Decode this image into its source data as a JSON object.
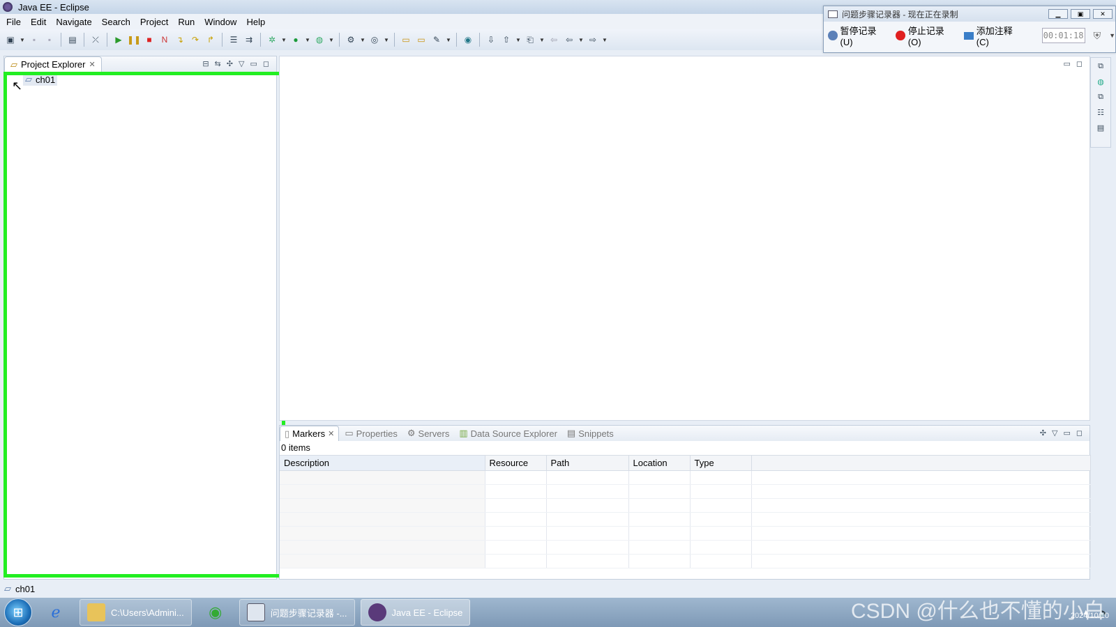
{
  "window": {
    "title": "Java EE - Eclipse"
  },
  "menu": [
    "File",
    "Edit",
    "Navigate",
    "Search",
    "Project",
    "Run",
    "Window",
    "Help"
  ],
  "toolbar": {
    "icons": [
      "new-icon",
      "save-icon",
      "save-all-icon",
      "print-icon",
      "skip-breakpoints-icon",
      "resume-icon",
      "suspend-icon",
      "terminate-icon",
      "disconnect-icon",
      "step-into-icon",
      "step-over-icon",
      "step-return-icon",
      "drop-to-frame-icon",
      "use-step-filters-icon",
      "debug-icon",
      "run-icon",
      "run-last-tool-icon",
      "new-server-icon",
      "new-web-service-icon",
      "open-type-icon",
      "open-task-icon",
      "search-icon",
      "globe-icon",
      "next-annotation-icon",
      "prev-annotation-icon",
      "last-edit-icon",
      "back-icon",
      "forward-icon"
    ]
  },
  "step_recorder": {
    "title": "问题步骤记录器 - 现在正在录制",
    "pause_label": "暂停记录(U)",
    "stop_label": "停止记录(O)",
    "comment_label": "添加注释(C)",
    "timer": "00:01:18"
  },
  "explorer": {
    "tab_label": "Project Explorer",
    "tree": [
      {
        "label": "ch01"
      }
    ]
  },
  "bottom": {
    "tabs": [
      {
        "label": "Markers",
        "active": true
      },
      {
        "label": "Properties",
        "active": false
      },
      {
        "label": "Servers",
        "active": false
      },
      {
        "label": "Data Source Explorer",
        "active": false
      },
      {
        "label": "Snippets",
        "active": false
      }
    ],
    "items_label": "0 items",
    "columns": [
      "Description",
      "Resource",
      "Path",
      "Location",
      "Type"
    ]
  },
  "status": {
    "selection": "ch01"
  },
  "taskbar": {
    "tasks": [
      {
        "label": "C:\\Users\\Admini...",
        "active": false
      },
      {
        "label": "问题步骤记录器 -...",
        "active": false
      },
      {
        "label": "Java EE - Eclipse",
        "active": true
      }
    ],
    "watermark": "CSDN @什么也不懂的小白",
    "date": "2024/10/10"
  },
  "colors": {
    "highlight": "#22ee22",
    "stop_red": "#e02020"
  }
}
